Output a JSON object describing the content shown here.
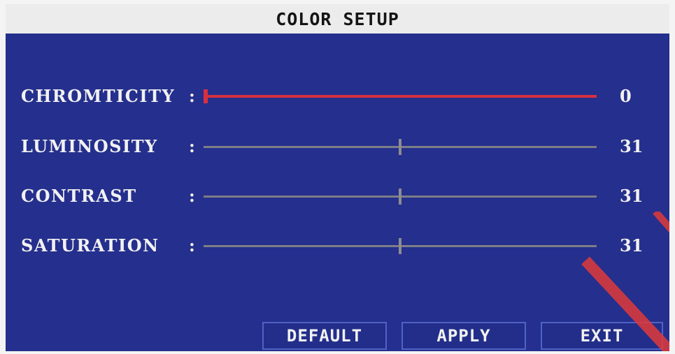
{
  "title": "COLOR SETUP",
  "sliders": [
    {
      "label": "CHROMTICITY",
      "value": "0",
      "fraction": 0.0
    },
    {
      "label": "LUMINOSITY",
      "value": "31",
      "fraction": 0.5
    },
    {
      "label": "CONTRAST",
      "value": "31",
      "fraction": 0.5
    },
    {
      "label": "SATURATION",
      "value": "31",
      "fraction": 0.5
    }
  ],
  "colon": ":",
  "buttons": {
    "default": "DEFAULT",
    "apply": "APPLY",
    "exit": "EXIT"
  },
  "colors": {
    "panel": "#252f8d",
    "titlebar": "#ececec",
    "active_slider": "#d43040",
    "slider": "#7e7e86",
    "button_border": "#4f62c6",
    "watermark": "#e03a3a"
  }
}
